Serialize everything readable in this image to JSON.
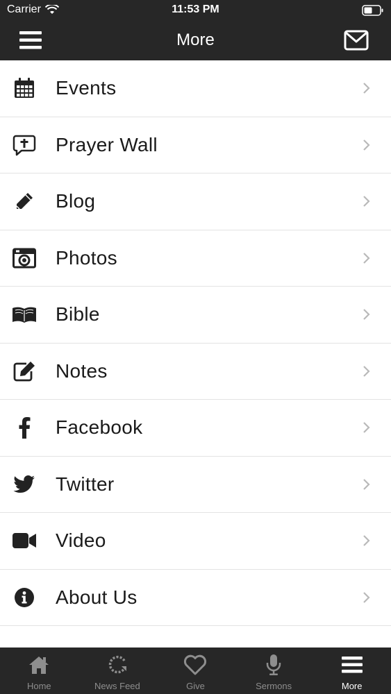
{
  "status_bar": {
    "carrier": "Carrier",
    "time": "11:53 PM"
  },
  "nav": {
    "title": "More",
    "left_icon": "hamburger-menu-icon",
    "right_icon": "mail-envelope-icon"
  },
  "colors": {
    "bar_background": "#272727",
    "row_text": "#1a1a1a",
    "tab_inactive": "#8e8e8e",
    "tab_active": "#ffffff",
    "chevron": "#b9b9b9"
  },
  "menu_items": [
    {
      "label": "Events",
      "icon": "calendar-icon"
    },
    {
      "label": "Prayer Wall",
      "icon": "prayer-bubble-icon"
    },
    {
      "label": "Blog",
      "icon": "pencil-icon"
    },
    {
      "label": "Photos",
      "icon": "camera-icon"
    },
    {
      "label": "Bible",
      "icon": "open-book-icon"
    },
    {
      "label": "Notes",
      "icon": "edit-note-icon"
    },
    {
      "label": "Facebook",
      "icon": "facebook-icon"
    },
    {
      "label": "Twitter",
      "icon": "twitter-icon"
    },
    {
      "label": "Video",
      "icon": "video-camera-icon"
    },
    {
      "label": "About Us",
      "icon": "info-icon"
    }
  ],
  "tabs": [
    {
      "label": "Home",
      "icon": "home-icon",
      "active": false
    },
    {
      "label": "News Feed",
      "icon": "refresh-icon",
      "active": false
    },
    {
      "label": "Give",
      "icon": "heart-icon",
      "active": false
    },
    {
      "label": "Sermons",
      "icon": "microphone-icon",
      "active": false
    },
    {
      "label": "More",
      "icon": "more-menu-icon",
      "active": true
    }
  ]
}
